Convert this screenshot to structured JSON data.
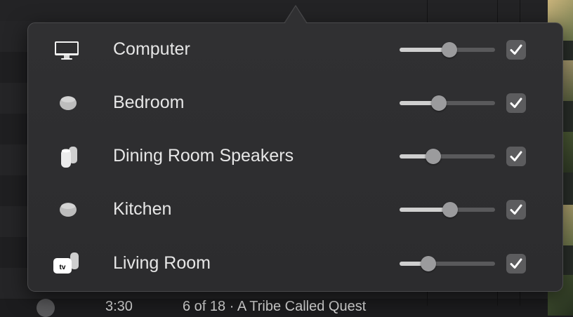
{
  "background": {
    "bottom_time": "3:30",
    "bottom_track": "6 of 18 · A Tribe Called Quest"
  },
  "devices": [
    {
      "label": "Computer",
      "icon": "computer-icon",
      "volume": 0.52,
      "checked": true
    },
    {
      "label": "Bedroom",
      "icon": "homepod-mini-icon",
      "volume": 0.41,
      "checked": true
    },
    {
      "label": "Dining Room Speakers",
      "icon": "homepod-pair-icon",
      "volume": 0.35,
      "checked": true
    },
    {
      "label": "Kitchen",
      "icon": "homepod-mini-icon",
      "volume": 0.53,
      "checked": true
    },
    {
      "label": "Living Room",
      "icon": "appletv-homepod-icon",
      "volume": 0.3,
      "checked": true
    }
  ]
}
